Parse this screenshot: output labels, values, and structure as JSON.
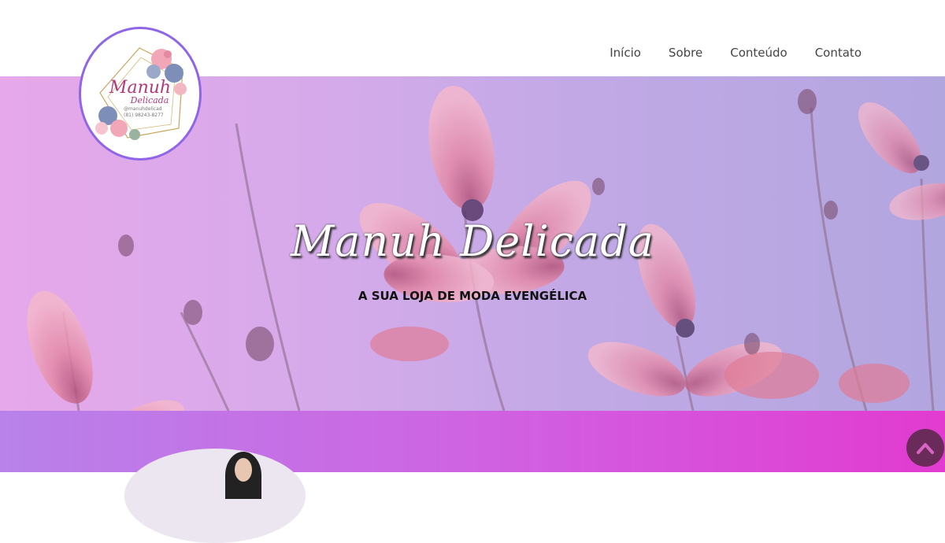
{
  "header": {
    "logo": {
      "brand_line1": "Manuh",
      "brand_line2": "Delicada",
      "instagram": "@manuhdelicad",
      "phone": "(81) 98243-8277"
    },
    "nav": [
      {
        "label": "Início"
      },
      {
        "label": "Sobre"
      },
      {
        "label": "Conteúdo"
      },
      {
        "label": "Contato"
      }
    ]
  },
  "hero": {
    "title": "Manuh Delicada",
    "subtitle": "A SUA LOJA DE MODA EVENGÉLICA"
  },
  "colors": {
    "accent": "#8f66e6",
    "brand_pink": "#b23a7a",
    "lower_gradient_start": "#b882ea",
    "lower_gradient_end": "#e23bd0",
    "back_to_top": "#6a2a5a"
  },
  "icons": {
    "back_to_top": "chevron-up-icon"
  }
}
